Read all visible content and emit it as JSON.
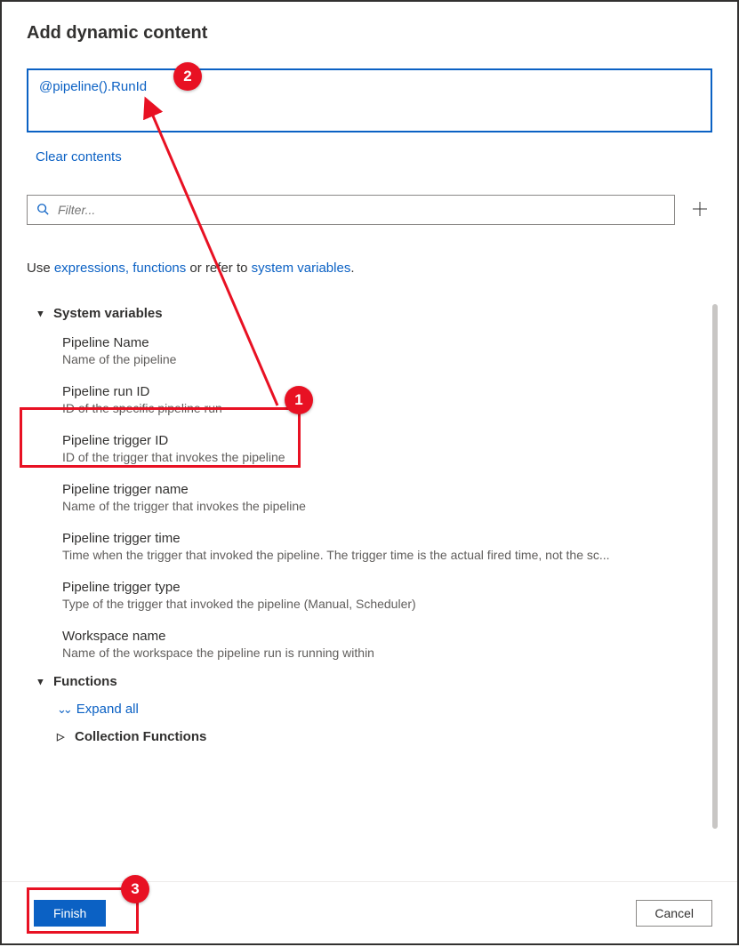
{
  "title": "Add dynamic content",
  "expression": "@pipeline().RunId",
  "clear_label": "Clear contents",
  "filter_placeholder": "Filter...",
  "hint": {
    "prefix": "Use ",
    "link1": "expressions, functions",
    "middle": " or refer to ",
    "link2": "system variables",
    "suffix": "."
  },
  "sections": {
    "system_variables": {
      "label": "System variables",
      "items": [
        {
          "title": "Pipeline Name",
          "desc": "Name of the pipeline"
        },
        {
          "title": "Pipeline run ID",
          "desc": "ID of the specific pipeline run"
        },
        {
          "title": "Pipeline trigger ID",
          "desc": "ID of the trigger that invokes the pipeline"
        },
        {
          "title": "Pipeline trigger name",
          "desc": "Name of the trigger that invokes the pipeline"
        },
        {
          "title": "Pipeline trigger time",
          "desc": "Time when the trigger that invoked the pipeline. The trigger time is the actual fired time, not the sc..."
        },
        {
          "title": "Pipeline trigger type",
          "desc": "Type of the trigger that invoked the pipeline (Manual, Scheduler)"
        },
        {
          "title": "Workspace name",
          "desc": "Name of the workspace the pipeline run is running within"
        }
      ]
    },
    "functions": {
      "label": "Functions",
      "expand_all": "Expand all",
      "sub": "Collection Functions"
    }
  },
  "footer": {
    "finish": "Finish",
    "cancel": "Cancel"
  },
  "callouts": {
    "c1": "1",
    "c2": "2",
    "c3": "3"
  }
}
